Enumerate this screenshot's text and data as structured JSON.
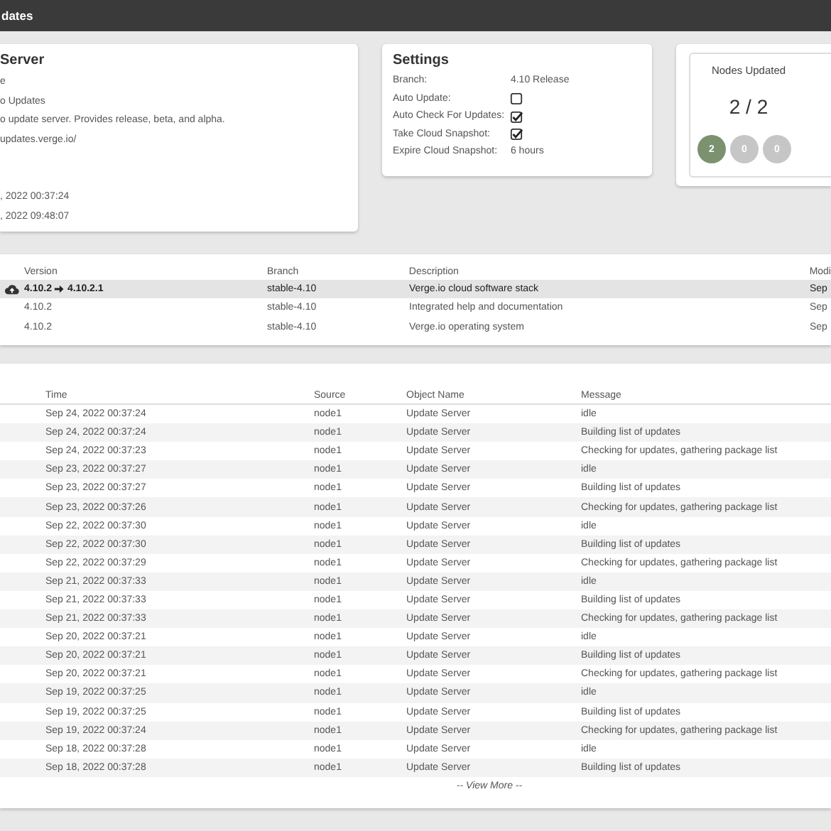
{
  "header": {
    "title": "dates"
  },
  "server": {
    "title": "Server",
    "lines": [
      "e",
      "o Updates",
      "o update server.  Provides release, beta, and alpha.",
      "updates.verge.io/"
    ],
    "dates": [
      ", 2022 00:37:24",
      ", 2022 09:48:07"
    ]
  },
  "settings": {
    "title": "Settings",
    "rows": [
      {
        "label": "Branch:",
        "kind": "text",
        "value": "4.10 Release"
      },
      {
        "label": "Auto Update:",
        "kind": "checkbox",
        "checked": false
      },
      {
        "label": "Auto Check For Updates:",
        "kind": "checkbox",
        "checked": true
      },
      {
        "label": "Take Cloud Snapshot:",
        "kind": "checkbox",
        "checked": true
      },
      {
        "label": "Expire Cloud Snapshot:",
        "kind": "text",
        "value": "6 hours"
      }
    ]
  },
  "nodes": {
    "title": "Nodes Updated",
    "count": "2 / 2",
    "badges": [
      {
        "value": "2",
        "color": "#7b9170"
      },
      {
        "value": "0",
        "color": "#c6c6c6"
      },
      {
        "value": "0",
        "color": "#c6c6c6"
      }
    ]
  },
  "packages": {
    "columns": [
      "Version",
      "Branch",
      "Description",
      "Modi"
    ],
    "rows": [
      {
        "version": "4.10.2",
        "new_version": "4.10.2.1",
        "update_available": true,
        "branch": "stable-4.10",
        "description": "Verge.io cloud software stack",
        "modified": "Sep"
      },
      {
        "version": "4.10.2",
        "update_available": false,
        "branch": "stable-4.10",
        "description": "Integrated help and documentation",
        "modified": "Sep"
      },
      {
        "version": "4.10.2",
        "update_available": false,
        "branch": "stable-4.10",
        "description": "Verge.io operating system",
        "modified": "Sep"
      }
    ]
  },
  "log": {
    "columns": [
      "Time",
      "Source",
      "Object Name",
      "Message"
    ],
    "rows": [
      [
        "Sep 24, 2022 00:37:24",
        "node1",
        "Update Server",
        "idle"
      ],
      [
        "Sep 24, 2022 00:37:24",
        "node1",
        "Update Server",
        "Building list of updates"
      ],
      [
        "Sep 24, 2022 00:37:23",
        "node1",
        "Update Server",
        "Checking for updates, gathering package list"
      ],
      [
        "Sep 23, 2022 00:37:27",
        "node1",
        "Update Server",
        "idle"
      ],
      [
        "Sep 23, 2022 00:37:27",
        "node1",
        "Update Server",
        "Building list of updates"
      ],
      [
        "Sep 23, 2022 00:37:26",
        "node1",
        "Update Server",
        "Checking for updates, gathering package list"
      ],
      [
        "Sep 22, 2022 00:37:30",
        "node1",
        "Update Server",
        "idle"
      ],
      [
        "Sep 22, 2022 00:37:30",
        "node1",
        "Update Server",
        "Building list of updates"
      ],
      [
        "Sep 22, 2022 00:37:29",
        "node1",
        "Update Server",
        "Checking for updates, gathering package list"
      ],
      [
        "Sep 21, 2022 00:37:33",
        "node1",
        "Update Server",
        "idle"
      ],
      [
        "Sep 21, 2022 00:37:33",
        "node1",
        "Update Server",
        "Building list of updates"
      ],
      [
        "Sep 21, 2022 00:37:33",
        "node1",
        "Update Server",
        "Checking for updates, gathering package list"
      ],
      [
        "Sep 20, 2022 00:37:21",
        "node1",
        "Update Server",
        "idle"
      ],
      [
        "Sep 20, 2022 00:37:21",
        "node1",
        "Update Server",
        "Building list of updates"
      ],
      [
        "Sep 20, 2022 00:37:21",
        "node1",
        "Update Server",
        "Checking for updates, gathering package list"
      ],
      [
        "Sep 19, 2022 00:37:25",
        "node1",
        "Update Server",
        "idle"
      ],
      [
        "Sep 19, 2022 00:37:25",
        "node1",
        "Update Server",
        "Building list of updates"
      ],
      [
        "Sep 19, 2022 00:37:24",
        "node1",
        "Update Server",
        "Checking for updates, gathering package list"
      ],
      [
        "Sep 18, 2022 00:37:28",
        "node1",
        "Update Server",
        "idle"
      ],
      [
        "Sep 18, 2022 00:37:28",
        "node1",
        "Update Server",
        "Building list of updates"
      ]
    ],
    "more": "-- View More --"
  }
}
